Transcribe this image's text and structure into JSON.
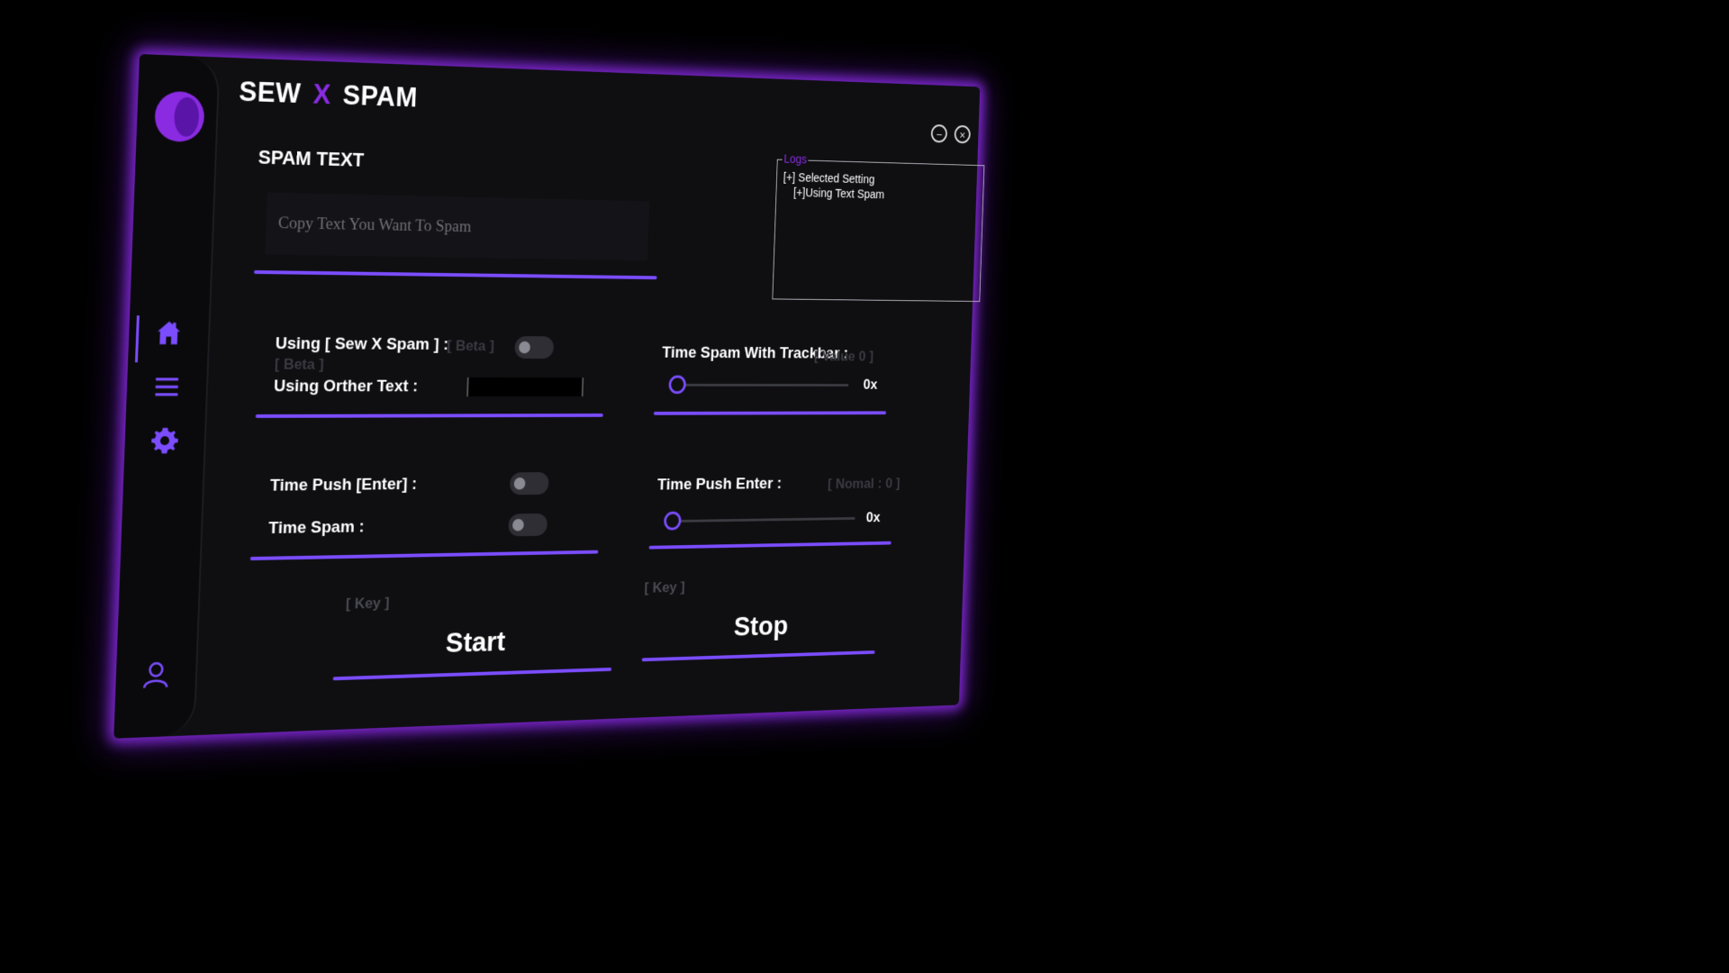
{
  "app": {
    "title_left": "SEW",
    "title_mid": "X",
    "title_right": "SPAM",
    "minimize_symbol": "−",
    "close_symbol": "×"
  },
  "sidebar": {
    "items": [
      {
        "name": "home-icon",
        "active": true
      },
      {
        "name": "menu-icon"
      },
      {
        "name": "gear-icon"
      },
      {
        "name": "user-icon"
      }
    ],
    "accent": "#7b4dff"
  },
  "spam_text": {
    "label": "SPAM TEXT",
    "placeholder": "Copy Text You Want To Spam",
    "value": ""
  },
  "logs": {
    "title": "Logs",
    "lines": [
      "[+] Selected Setting",
      "[+]Using Text Spam"
    ]
  },
  "options": {
    "using_sew_x_spam": "Using [ Sew X Spam ] :",
    "beta_tag": "[ Beta ]",
    "beta_tag_2": "[ Beta ]",
    "using_other_text": "Using Orther Text :",
    "time_push_enter": "Time Push [Enter] :",
    "time_spam": "Time Spam :"
  },
  "sliders": {
    "time_spam_trackbar": {
      "label": "Time Spam With Trackbar :",
      "hint": "[ Value 0 ]",
      "value": "0x",
      "fraction": 0
    },
    "time_push_enter": {
      "label": "Time Push Enter :",
      "hint": "[ Nomal : 0 ]",
      "value": "0x",
      "fraction": 0
    }
  },
  "actions": {
    "start_key": "[ Key ]",
    "start_label": "Start",
    "stop_key": "[ Key ]",
    "stop_label": "Stop"
  },
  "colors": {
    "accent": "#8a2be2",
    "underline": "#7b4dff",
    "background": "#0f0f12"
  }
}
